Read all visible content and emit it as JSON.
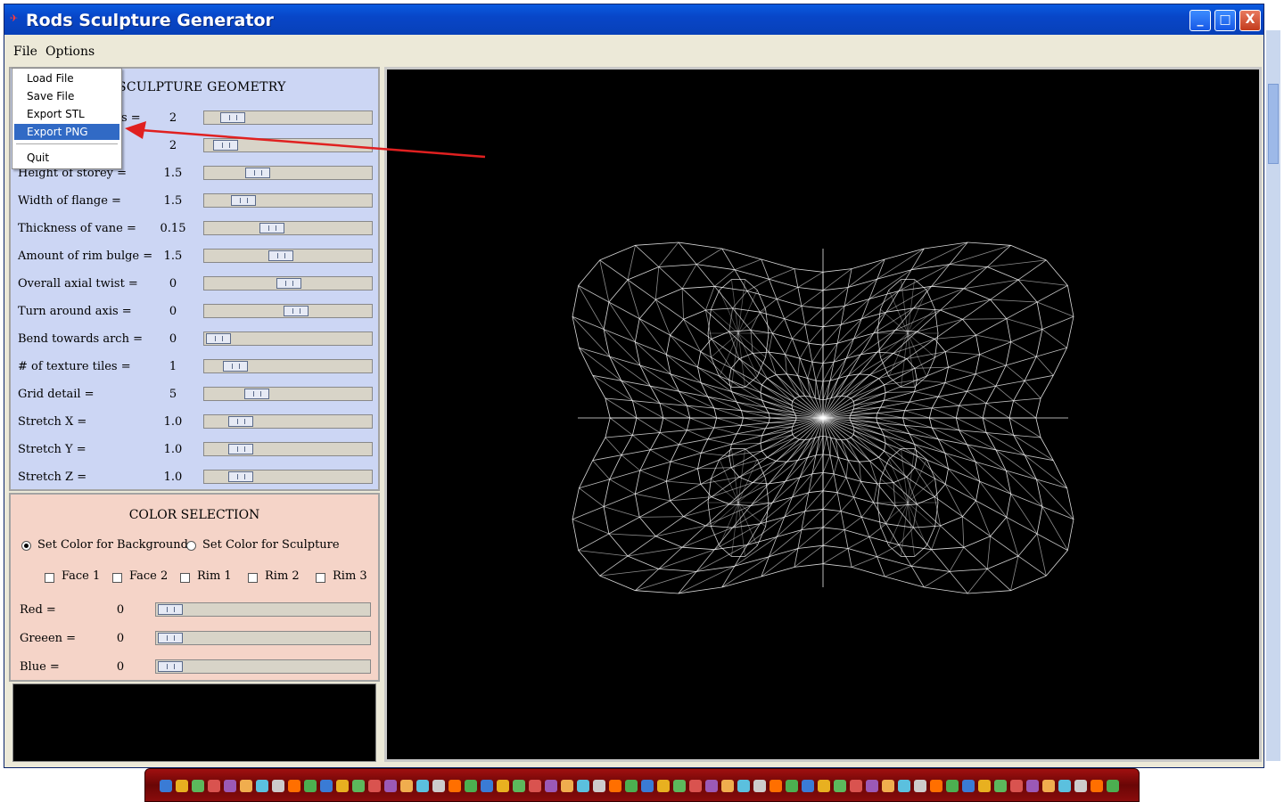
{
  "window": {
    "title": "Rods Sculpture Generator",
    "controls": {
      "minimize": "_",
      "maximize": "□",
      "close": "X"
    }
  },
  "menu": {
    "file": "File",
    "options": "Options"
  },
  "file_menu": {
    "items": [
      "Load File",
      "Save File",
      "Export STL",
      "Export PNG",
      "Quit"
    ],
    "selected": "Export PNG"
  },
  "geometry": {
    "title": "SCULPTURE GEOMETRY",
    "rows": [
      {
        "label": "",
        "value": "2",
        "level": 0.1
      },
      {
        "label": "",
        "value": "2",
        "level": 0.05
      },
      {
        "label": "Height of storey =",
        "value": "1.5",
        "level": 0.28
      },
      {
        "label": "Width of flange =",
        "value": "1.5",
        "level": 0.18
      },
      {
        "label": "Thickness of vane =",
        "value": "0.15",
        "level": 0.38
      },
      {
        "label": "Amount of rim bulge =",
        "value": "1.5",
        "level": 0.44
      },
      {
        "label": "Overall axial twist =",
        "value": "0",
        "level": 0.5
      },
      {
        "label": "Turn around axis =",
        "value": "0",
        "level": 0.55
      },
      {
        "label": "Bend towards arch =",
        "value": "0",
        "level": 0.0
      },
      {
        "label": "# of texture tiles =",
        "value": "1",
        "level": 0.12
      },
      {
        "label": "Grid detail =",
        "value": "5",
        "level": 0.27
      },
      {
        "label": "Stretch X =",
        "value": "1.0",
        "level": 0.16
      },
      {
        "label": "Stretch Y =",
        "value": "1.0",
        "level": 0.16
      },
      {
        "label": "Stretch Z =",
        "value": "1.0",
        "level": 0.16
      }
    ],
    "row_labels_partial": [
      "s =",
      ""
    ]
  },
  "color": {
    "title": "COLOR SELECTION",
    "radio_background": "Set Color for Background",
    "radio_sculpture": "Set Color for Sculpture",
    "checks": [
      "Face 1",
      "Face 2",
      "Rim 1",
      "Rim 2",
      "Rim 3"
    ],
    "sliders": [
      {
        "label": "Red =",
        "value": "0",
        "level": 0.0
      },
      {
        "label": "Greeen =",
        "value": "0",
        "level": 0.0
      },
      {
        "label": "Blue =",
        "value": "0",
        "level": 0.0
      }
    ]
  },
  "colors": {
    "titlebar": "#0846c8",
    "geometry_panel": "#ccd6f4",
    "color_panel": "#f5d4c8",
    "viewport": "#000000",
    "wireframe": "#ffffff",
    "arrow": "#e02020",
    "taskbar": "#8a0c0c"
  }
}
